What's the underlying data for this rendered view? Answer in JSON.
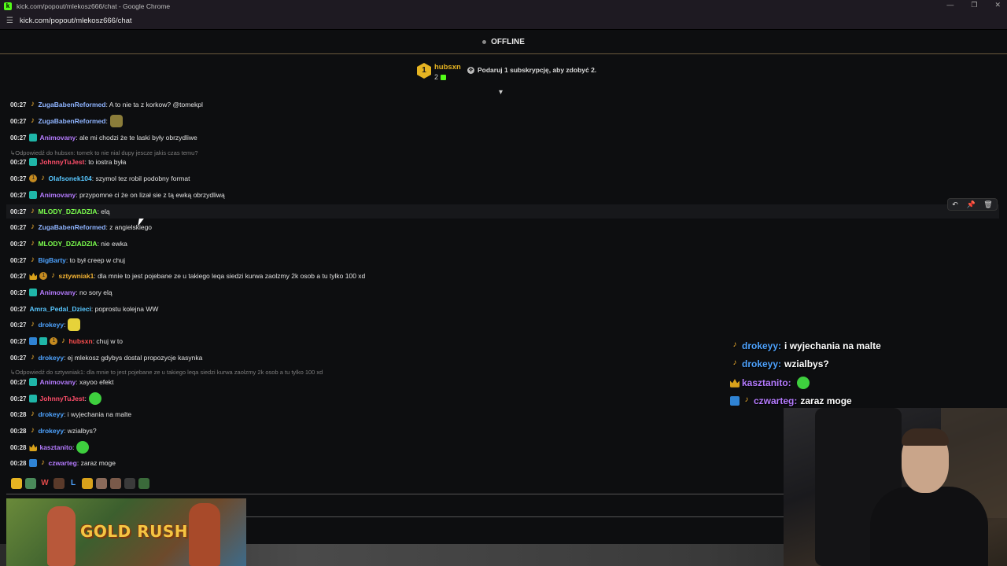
{
  "window": {
    "title": "kick.com/popout/mlekosz666/chat - Google Chrome",
    "url": "kick.com/popout/mlekosz666/chat",
    "logo_letter": "k"
  },
  "status": {
    "label": "OFFLINE"
  },
  "pinned": {
    "leader_rank": "1",
    "leader_name": "hubsxn",
    "leader_count": "2",
    "sub_promo": "Podaruj 1 subskrypcję, aby zdobyć 2."
  },
  "colors": {
    "accent_green": "#53fc18",
    "gold": "#e6b422",
    "user_blue": "#4ea3ff",
    "user_lime": "#7cff4e",
    "user_purple": "#b57bff",
    "user_red": "#ff4e4e",
    "user_orange": "#f2b233",
    "user_cyan": "#58c7ff"
  },
  "messages": [
    {
      "time": "00:27",
      "badges": [
        "sub"
      ],
      "user": "ZugaBabenReformed",
      "color": "#8fb4ff",
      "text": ": A to nie ta z korkow? @tomekpl"
    },
    {
      "time": "00:27",
      "badges": [
        "sub"
      ],
      "user": "ZugaBabenReformed",
      "color": "#8fb4ff",
      "text": ":",
      "emote": "frog-emote"
    },
    {
      "time": "00:27",
      "badges": [
        "vip"
      ],
      "user": "Animovany",
      "color": "#b57bff",
      "text": ": ale mi chodzi że te laski były obrzydliwe"
    },
    {
      "time": "00:27",
      "badges": [
        "vip"
      ],
      "user": "JohnnyTuJest",
      "color": "#ff4e6a",
      "text": ": to iostra była",
      "reply": "Odpowiedź do hubsxn: tomek to nie nial dupy jescze jakis czas temu?"
    },
    {
      "time": "00:27",
      "badges": [
        "gift",
        "sub"
      ],
      "user": "Olafsonek104",
      "color": "#58c7ff",
      "text": ": szymol tez robil podobny format"
    },
    {
      "time": "00:27",
      "badges": [
        "vip"
      ],
      "user": "Animovany",
      "color": "#b57bff",
      "text": ": przypomne ci że on lizał sie z tą ewką obrzydliwą"
    },
    {
      "time": "00:27",
      "badges": [
        "sub"
      ],
      "user": "MLODY_DZIADZIA",
      "color": "#7cff4e",
      "text": ": elą"
    },
    {
      "time": "00:27",
      "badges": [
        "sub"
      ],
      "user": "ZugaBabenReformed",
      "color": "#8fb4ff",
      "text": ": z angielskiego"
    },
    {
      "time": "00:27",
      "badges": [
        "sub"
      ],
      "user": "MLODY_DZIADZIA",
      "color": "#7cff4e",
      "text": ": nie ewka"
    },
    {
      "time": "00:27",
      "badges": [
        "sub"
      ],
      "user": "BigBarty",
      "color": "#4ea3ff",
      "text": ": to był creep w chuj"
    },
    {
      "time": "00:27",
      "badges": [
        "crown",
        "gift",
        "sub"
      ],
      "user": "sztywniak1",
      "color": "#f2b233",
      "text": ": dla mnie to jest pojebane ze u takiego leqa siedzi kurwa zaolzmy 2k osob a tu tylko 100 xd"
    },
    {
      "time": "00:27",
      "badges": [
        "vip"
      ],
      "user": "Animovany",
      "color": "#b57bff",
      "text": ": no sory elą"
    },
    {
      "time": "00:27",
      "badges": [],
      "user": "Amra_Pedal_Dzieci",
      "color": "#58c7ff",
      "text": ": poprostu kolejna WW"
    },
    {
      "time": "00:27",
      "badges": [
        "sub"
      ],
      "user": "drokeyy",
      "color": "#4ea3ff",
      "text": ":",
      "emote": "spongebob-emote"
    },
    {
      "time": "00:27",
      "badges": [
        "og",
        "vip",
        "gift",
        "sub"
      ],
      "user": "hubsxn",
      "color": "#ff4e4e",
      "text": ": chuj w to"
    },
    {
      "time": "00:27",
      "badges": [
        "sub"
      ],
      "user": "drokeyy",
      "color": "#4ea3ff",
      "text": ": ej mlekosz gdybys dostal propozycje kasynka"
    },
    {
      "time": "00:27",
      "badges": [
        "vip"
      ],
      "user": "Animovany",
      "color": "#b57bff",
      "text": ": xayoo efekt",
      "reply": "Odpowiedź do sztywniak1: dla mnie to jest pojebane ze u takiego leqa siedzi kurwa zaolzmy 2k osob a tu tylko 100 xd"
    },
    {
      "time": "00:27",
      "badges": [
        "vip"
      ],
      "user": "JohnnyTuJest",
      "color": "#ff4e6a",
      "text": ":",
      "emote": "green-blob-emote"
    },
    {
      "time": "00:28",
      "badges": [
        "sub"
      ],
      "user": "drokeyy",
      "color": "#4ea3ff",
      "text": ": i wyjechania na malte"
    },
    {
      "time": "00:28",
      "badges": [
        "sub"
      ],
      "user": "drokeyy",
      "color": "#4ea3ff",
      "text": ": wzialbys?"
    },
    {
      "time": "00:28",
      "badges": [
        "crown"
      ],
      "user": "kasztanito",
      "color": "#b57bff",
      "text": ":",
      "emote": "green-blob-emote"
    },
    {
      "time": "00:28",
      "badges": [
        "og",
        "sub"
      ],
      "user": "czwarteg",
      "color": "#b57bff",
      "text": ": zaraz moge"
    }
  ],
  "hover_actions": [
    "reply-icon",
    "pin-icon",
    "delete-icon"
  ],
  "overlay": [
    {
      "badges": [
        "sub"
      ],
      "user": "drokeyy:",
      "color": "#4ea3ff",
      "text": "i wyjechania na malte"
    },
    {
      "badges": [
        "sub"
      ],
      "user": "drokeyy:",
      "color": "#4ea3ff",
      "text": "wzialbys?"
    },
    {
      "badges": [
        "crown"
      ],
      "user": "kasztanito:",
      "color": "#b57bff",
      "text": "",
      "emote": "green-blob-emote"
    },
    {
      "badges": [
        "og",
        "sub"
      ],
      "user": "czwarteg:",
      "color": "#b57bff",
      "text": "zaraz moge"
    }
  ],
  "game_banner": {
    "title": "GOLD RUSH"
  },
  "emote_strip_extra": [
    "W",
    "L"
  ]
}
